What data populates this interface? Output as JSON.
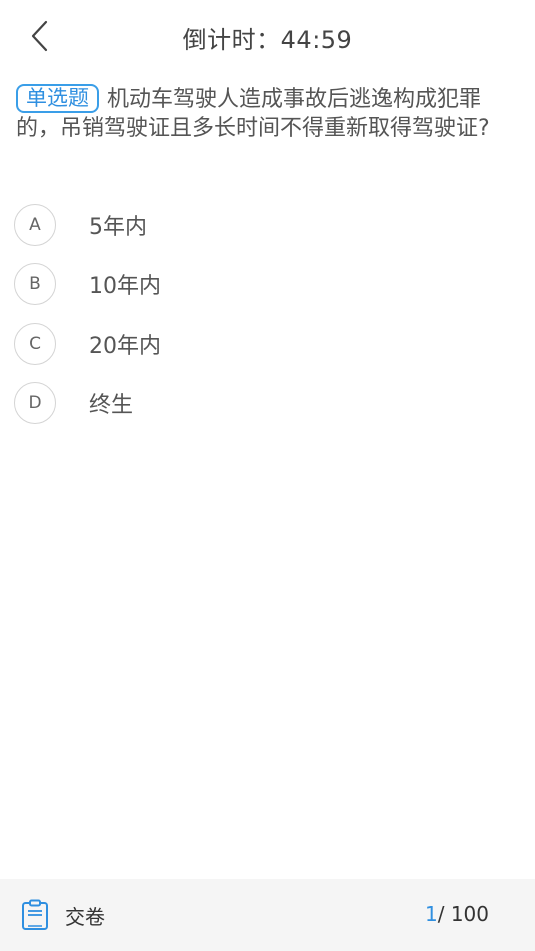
{
  "header": {
    "title": "倒计时：44:59"
  },
  "question": {
    "type_tag": "单选题",
    "text": "机动车驾驶人造成事故后逃逸构成犯罪的，吊销驾驶证且多长时间不得重新取得驾驶证?"
  },
  "options": [
    {
      "letter": "A",
      "text": "5年内"
    },
    {
      "letter": "B",
      "text": "10年内"
    },
    {
      "letter": "C",
      "text": "20年内"
    },
    {
      "letter": "D",
      "text": "终生"
    }
  ],
  "footer": {
    "submit_label": "交卷",
    "current": "1",
    "separator": "/",
    "total": "100",
    "submit_icon": "clipboard-100-icon"
  },
  "colors": {
    "accent": "#2f8fe0",
    "footer_bg": "#f5f5f5"
  }
}
